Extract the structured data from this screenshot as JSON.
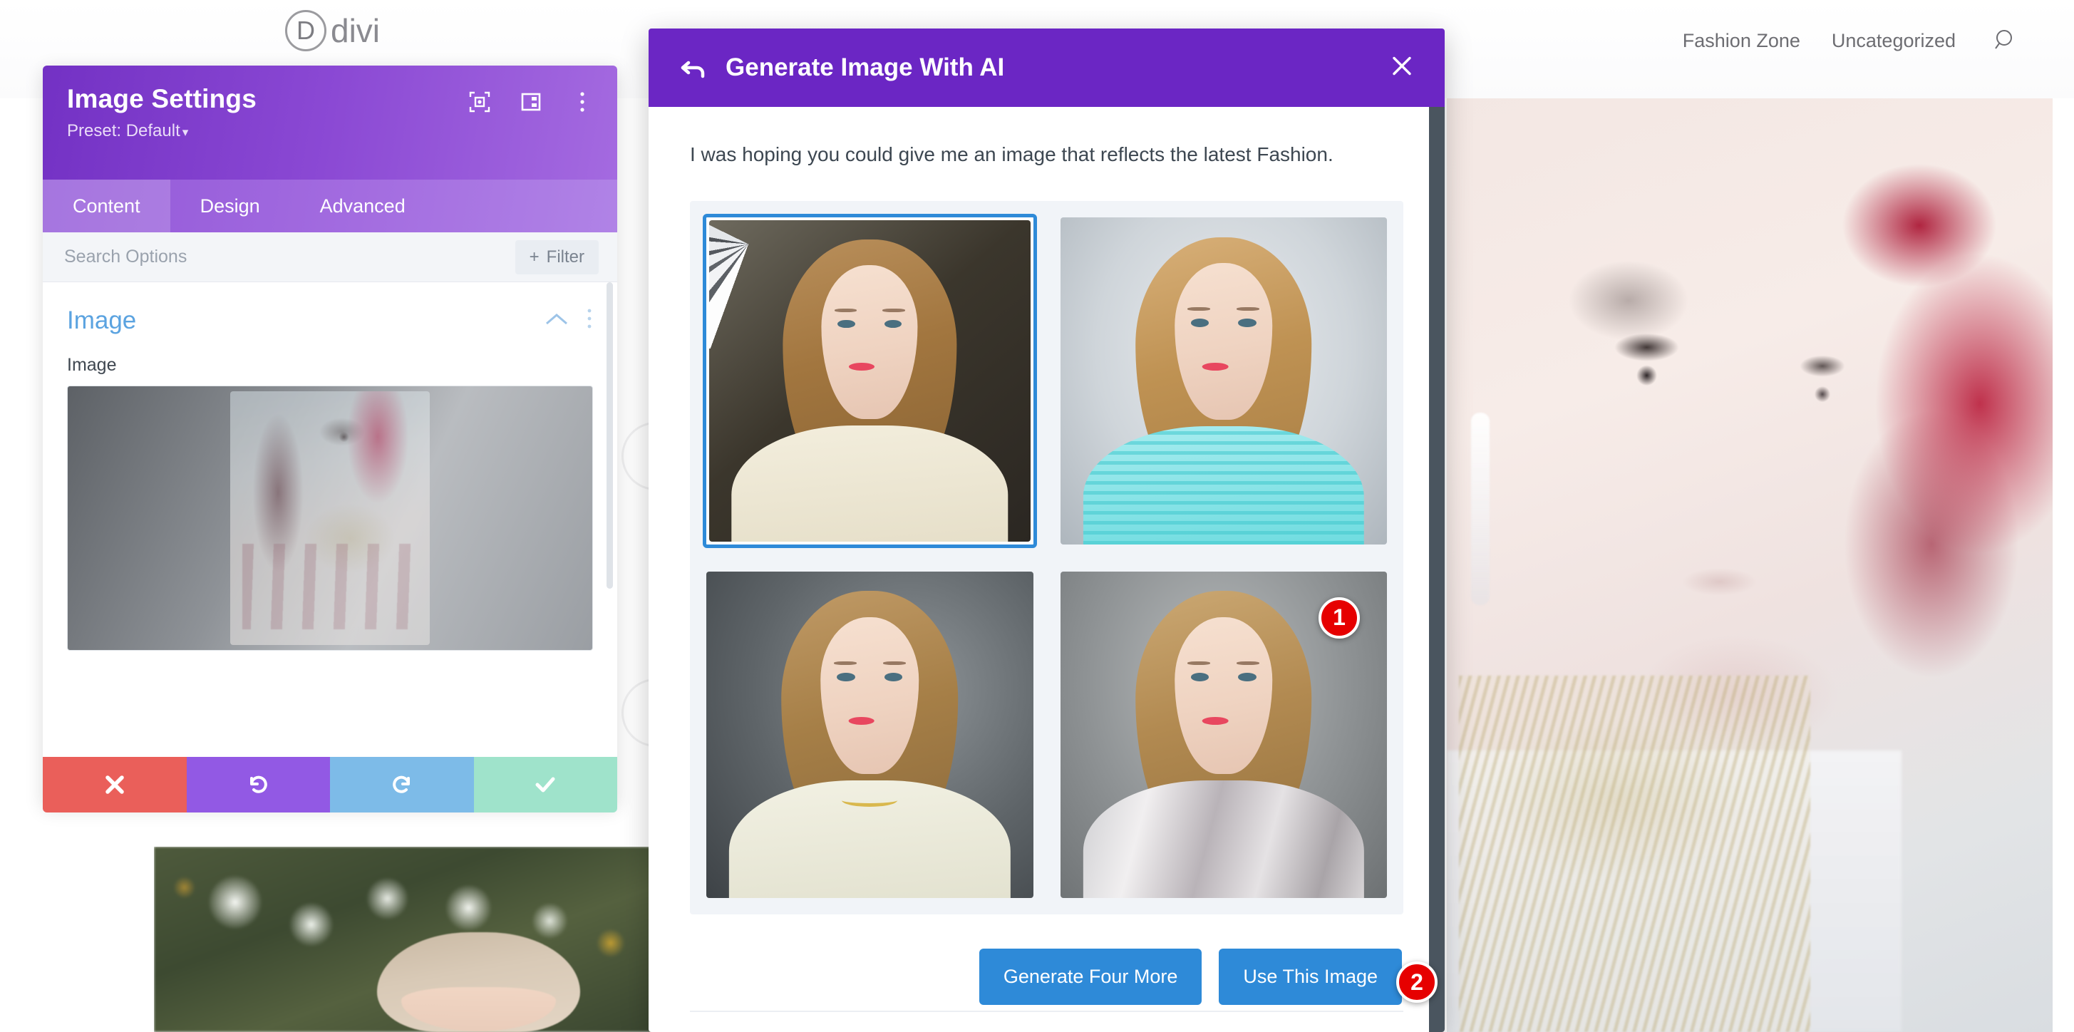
{
  "site": {
    "logo_letter": "D",
    "logo_word": "divi",
    "nav": [
      {
        "label": "Fashion Zone"
      },
      {
        "label": "Uncategorized"
      }
    ],
    "search_icon": "search-icon"
  },
  "settings_panel": {
    "title": "Image Settings",
    "preset_label": "Preset: Default",
    "preset_caret": "▾",
    "header_icons": [
      {
        "name": "focus-frame-icon"
      },
      {
        "name": "layout-columns-icon"
      },
      {
        "name": "more-vertical-icon"
      }
    ],
    "tabs": [
      {
        "label": "Content",
        "active": true
      },
      {
        "label": "Design",
        "active": false
      },
      {
        "label": "Advanced",
        "active": false
      }
    ],
    "search_placeholder": "Search Options",
    "filter_label": "Filter",
    "filter_plus": "+",
    "section": {
      "title": "Image",
      "collapse_icon": "chevron-up-icon",
      "menu_icon": "more-vertical-icon"
    },
    "field_label": "Image",
    "actions": [
      {
        "name": "cancel-button",
        "icon": "close-x-icon"
      },
      {
        "name": "undo-button",
        "icon": "undo-arrow-icon"
      },
      {
        "name": "redo-button",
        "icon": "redo-arrow-icon"
      },
      {
        "name": "save-button",
        "icon": "check-icon"
      }
    ]
  },
  "ai_modal": {
    "back_icon": "back-arrow-icon",
    "title": "Generate Image With AI",
    "close_icon": "close-x-icon",
    "prompt": "I was hoping you could give me an image that reflects the latest Fashion.",
    "results": [
      {
        "alt": "Blonde woman in cream sweater with studio umbrella light",
        "selected": true
      },
      {
        "alt": "Blonde woman in turquoise striped sweater",
        "selected": false
      },
      {
        "alt": "Blonde woman in cream top with gold necklace",
        "selected": false
      },
      {
        "alt": "Blonde woman in silver metallic top",
        "selected": false
      }
    ],
    "buttons": [
      {
        "label": "Generate Four More"
      },
      {
        "label": "Use This Image"
      }
    ]
  },
  "annotations": [
    {
      "id": "badge-one",
      "label": "1"
    },
    {
      "id": "badge-two",
      "label": "2"
    }
  ],
  "colors": {
    "modal_header": "#6b26c4",
    "panel_header": "#8b49d4",
    "primary_button": "#2e8ad8",
    "selection_border": "#2e8ad8",
    "annotation_badge": "#e60000",
    "section_title": "#5ba3e0"
  }
}
